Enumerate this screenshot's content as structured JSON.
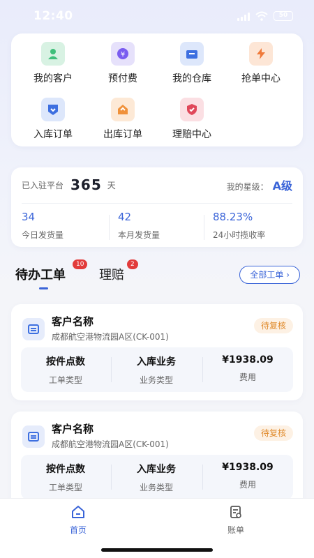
{
  "status_bar": {
    "time": "12:40",
    "battery": "50"
  },
  "menu": [
    {
      "label": "我的客户",
      "icon": "customer-icon",
      "bg": "#d8f2e3",
      "fg": "#3fbf7a"
    },
    {
      "label": "预付费",
      "icon": "prepaid-icon",
      "bg": "#e6e1fb",
      "fg": "#7a5cf0"
    },
    {
      "label": "我的仓库",
      "icon": "warehouse-icon",
      "bg": "#dde7fb",
      "fg": "#3d6fe0"
    },
    {
      "label": "抢单中心",
      "icon": "grab-order-icon",
      "bg": "#fde6d6",
      "fg": "#f07a3a"
    },
    {
      "label": "入库订单",
      "icon": "inbound-order-icon",
      "bg": "#dde7fb",
      "fg": "#3d6fe0"
    },
    {
      "label": "出库订单",
      "icon": "outbound-order-icon",
      "bg": "#fde9d6",
      "fg": "#f0913a"
    },
    {
      "label": "理赔中心",
      "icon": "claims-icon",
      "bg": "#fbdfe3",
      "fg": "#e0475a"
    }
  ],
  "stats": {
    "join_label": "已入驻平台",
    "join_days": "365",
    "join_unit": "天",
    "level_label": "我的星级：",
    "level_value": "A级",
    "items": [
      {
        "value": "34",
        "label": "今日发货量"
      },
      {
        "value": "42",
        "label": "本月发货量"
      },
      {
        "value": "88.23%",
        "label": "24小时揽收率"
      }
    ]
  },
  "tabs": [
    {
      "label": "待办工单",
      "badge": "10"
    },
    {
      "label": "理赔",
      "badge": "2"
    }
  ],
  "all_orders_label": "全部工单 ›",
  "orders": [
    {
      "name": "客户名称",
      "address": "成都航空港物流园A区(CK-001)",
      "status": "待复核",
      "info": [
        {
          "value": "按件点数",
          "label": "工单类型"
        },
        {
          "value": "入库业务",
          "label": "业务类型"
        },
        {
          "value": "¥1938.09",
          "label": "费用"
        }
      ]
    },
    {
      "name": "客户名称",
      "address": "成都航空港物流园A区(CK-001)",
      "status": "待复核",
      "info": [
        {
          "value": "按件点数",
          "label": "工单类型"
        },
        {
          "value": "入库业务",
          "label": "业务类型"
        },
        {
          "value": "¥1938.09",
          "label": "费用"
        }
      ]
    }
  ],
  "bottom_nav": [
    {
      "label": "首页",
      "icon": "home-icon",
      "active": true
    },
    {
      "label": "账单",
      "icon": "bill-icon",
      "active": false
    }
  ],
  "colors": {
    "accent": "#3a64d8",
    "badge": "#e23b3b",
    "pending": "#e08a2b"
  }
}
